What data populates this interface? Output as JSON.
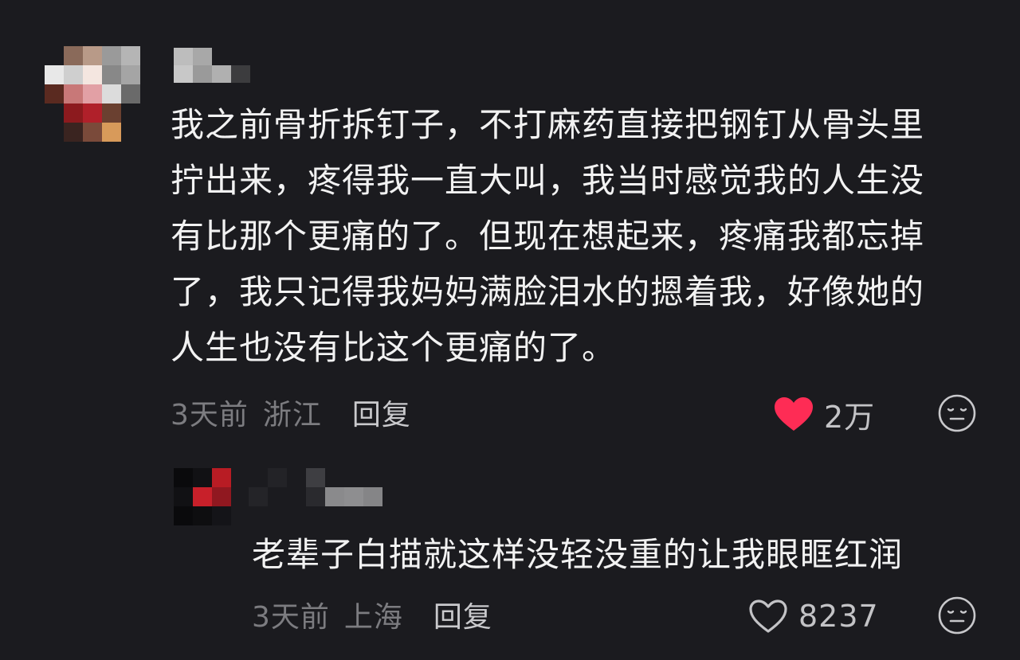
{
  "comments": [
    {
      "text": [
        "我之前骨折拆钉子，不打麻药直接把钢钉从骨头里",
        "拧出来，疼得我一直大叫，我当时感觉我的人生没",
        "有比那个更痛的了。但现在想起来，疼痛我都忘掉",
        "了，我只记得我妈妈满脸泪水的摁着我，好像她的",
        "人生也没有比这个更痛的了。"
      ],
      "time": "3天前",
      "location": "浙江",
      "reply_label": "回复",
      "like_count": "2万",
      "liked": true,
      "like_icon": "heart-filled-icon",
      "dislike_icon": "meh-face-icon"
    },
    {
      "text": [
        "老辈子白描就这样没轻没重的让我眼眶红润"
      ],
      "time": "3天前",
      "location": "上海",
      "reply_label": "回复",
      "like_count": "8237",
      "liked": false,
      "like_icon": "heart-outline-icon",
      "dislike_icon": "meh-face-icon"
    }
  ],
  "colors": {
    "background": "#1b1b1f",
    "like_red": "#fe2c55",
    "muted_text": "#7c7c80"
  }
}
